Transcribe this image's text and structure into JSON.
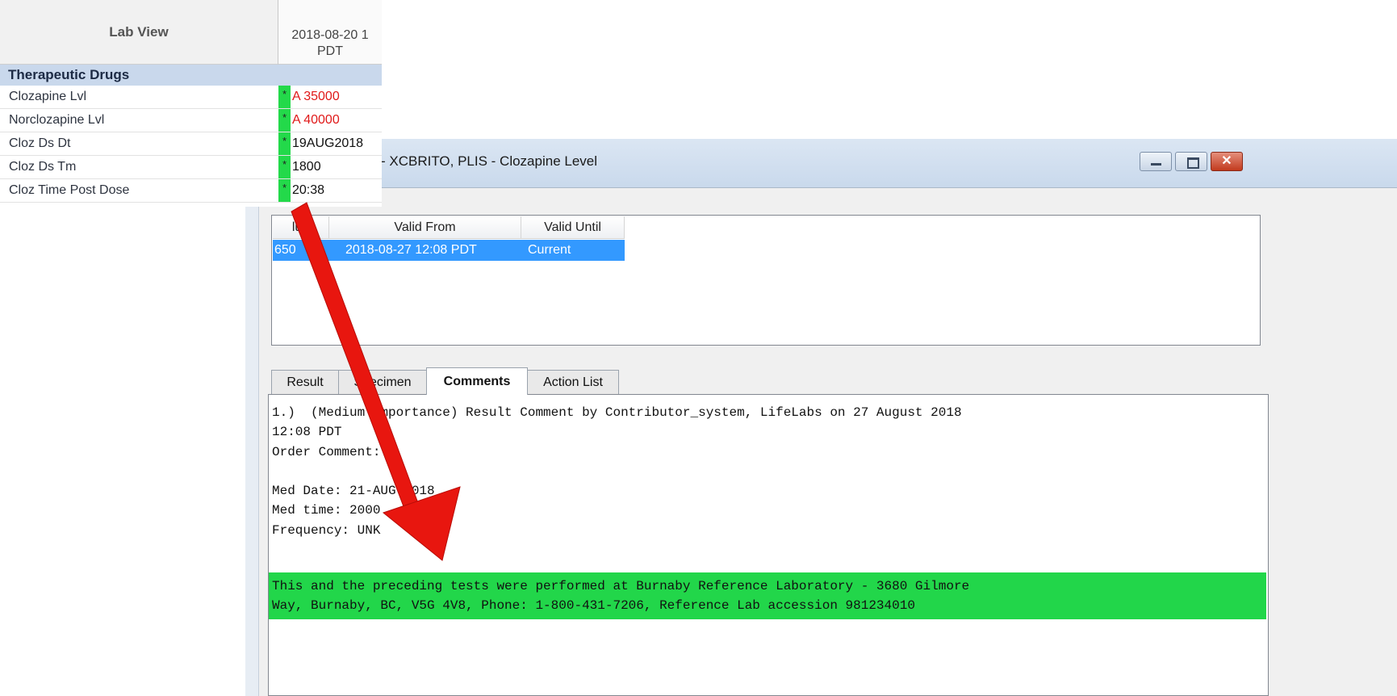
{
  "lab_view": {
    "header_label": "Lab View",
    "date_line1": "2018-08-20 1",
    "date_line2": "PDT",
    "section": "Therapeutic Drugs",
    "rows": [
      {
        "name": "Clozapine Lvl",
        "flag": "*",
        "value": "A 35000",
        "abnormal": true
      },
      {
        "name": "Norclozapine Lvl",
        "flag": "*",
        "value": "A 40000",
        "abnormal": true
      },
      {
        "name": "Cloz Ds Dt",
        "flag": "*",
        "value": "19AUG2018",
        "abnormal": false
      },
      {
        "name": "Cloz Ds Tm",
        "flag": "*",
        "value": "1800",
        "abnormal": false
      },
      {
        "name": "Cloz Time Post Dose",
        "flag": "*",
        "value": "20:38",
        "abnormal": false
      }
    ]
  },
  "dialog": {
    "title": "- XCBRITO, PLIS - Clozapine Level",
    "close_glyph": "✕",
    "history": {
      "columns": [
        "lue",
        "Valid From",
        "Valid Until"
      ],
      "row": [
        "650",
        "2018-08-27 12:08 PDT",
        "Current"
      ]
    },
    "tabs": [
      "Result",
      "Specimen",
      "Comments",
      "Action List"
    ],
    "active_tab": "Comments",
    "comment_lines": [
      "1.)  (Medium Importance) Result Comment by Contributor_system, LifeLabs on 27 August 2018",
      "12:08 PDT",
      "Order Comment:",
      "",
      "Med Date: 21-AUG-2018",
      "Med time: 2000",
      "Frequency: UNK"
    ],
    "lab_note_lines": [
      "This and the preceding tests were performed at Burnaby Reference Laboratory - 3680 Gilmore",
      "Way, Burnaby, BC, V5G 4V8, Phone: 1-800-431-7206, Reference Lab accession 981234010"
    ]
  },
  "colors": {
    "abnormal_value": "#e01919",
    "flag_green": "#23d94a",
    "highlight_green": "#22d64a",
    "selection_blue": "#3399ff",
    "arrow_red": "#e8160f"
  }
}
